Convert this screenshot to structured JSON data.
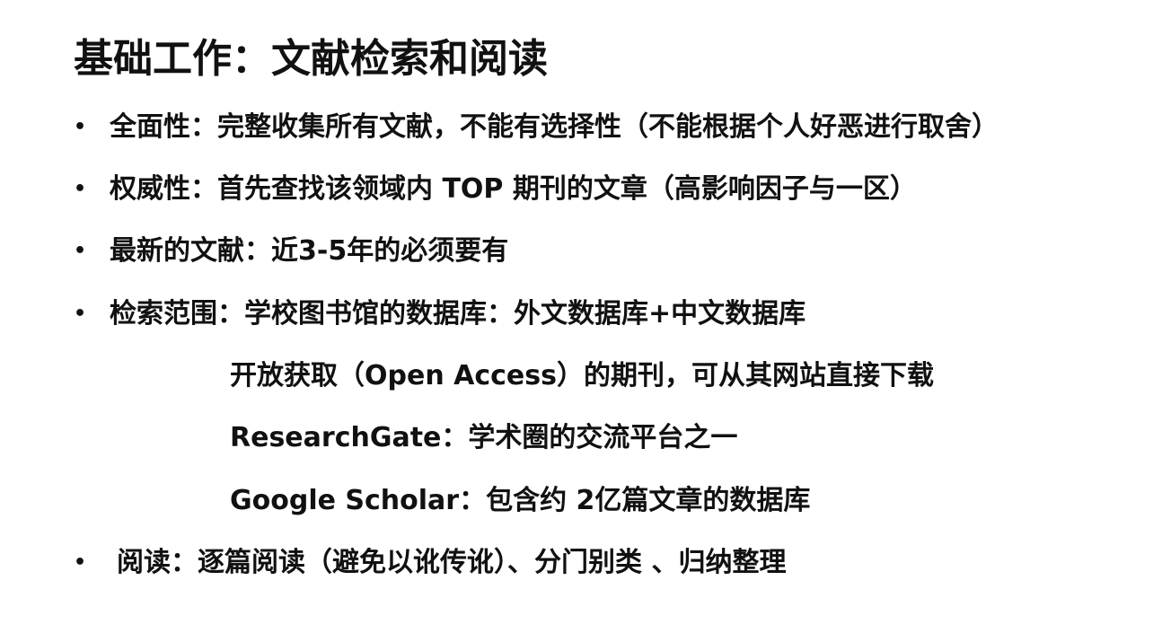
{
  "slide": {
    "title": "基础工作：文献检索和阅读",
    "bullet_symbol": "•",
    "bullets": [
      {
        "text": "全面性：完整收集所有文献，不能有选择性（不能根据个人好恶进行取舍）"
      },
      {
        "text": "权威性：首先查找该领域内 TOP 期刊的文章（高影响因子与一区）"
      },
      {
        "text": "最新的文献：近3-5年的必须要有"
      },
      {
        "text": "检索范围：学校图书馆的数据库：外文数据库+中文数据库"
      }
    ],
    "sub_items": [
      {
        "text": "开放获取（Open Access）的期刊，可从其网站直接下载"
      },
      {
        "text": "ResearchGate：学术圈的交流平台之一"
      },
      {
        "text": "Google Scholar：包含约 2亿篇文章的数据库"
      }
    ],
    "last_bullet": {
      "text": "阅读：逐篇阅读（避免以讹传讹）、分门别类 、归纳整理"
    }
  }
}
